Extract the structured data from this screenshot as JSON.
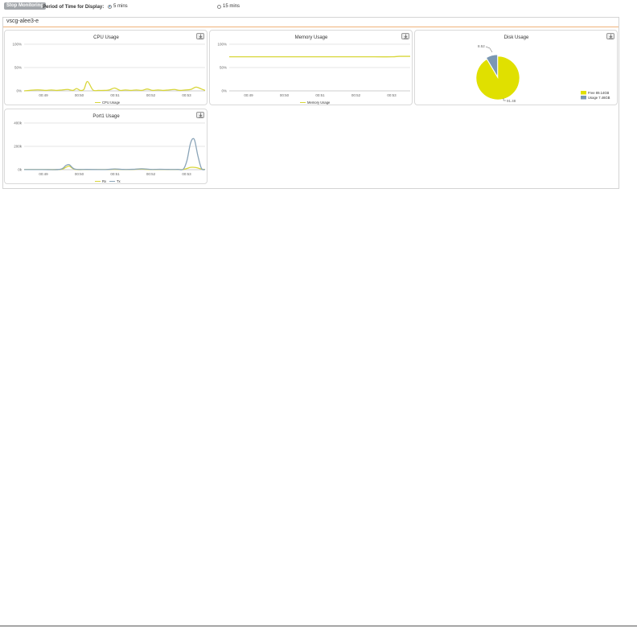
{
  "toolbar": {
    "stop_label": "Stop Monitoring",
    "period_label": "Period of Time for Display:",
    "options": [
      {
        "label": "5 mins",
        "selected": true
      },
      {
        "label": "15 mins",
        "selected": false
      }
    ]
  },
  "device": {
    "name": "vscg-alee3-e"
  },
  "colors": {
    "rx": "#d8d63a",
    "tx": "#8aa4b8",
    "free": "#e0e000",
    "usage": "#7a97b3",
    "grid": "#cccccc"
  },
  "chart_data": [
    {
      "type": "line",
      "title": "CPU Usage",
      "x_ticks": [
        "00:49",
        "00:50",
        "00:51",
        "00:52",
        "00:53"
      ],
      "y_ticks": [
        "100%",
        "50%",
        "0%"
      ],
      "ylim": [
        0,
        100
      ],
      "legend": [
        "CPU Usage"
      ],
      "series": [
        {
          "name": "CPU Usage",
          "color": "#d8d63a",
          "x": [
            0,
            0.03,
            0.06,
            0.09,
            0.12,
            0.15,
            0.18,
            0.21,
            0.24,
            0.27,
            0.29,
            0.31,
            0.33,
            0.35,
            0.38,
            0.41,
            0.44,
            0.47,
            0.5,
            0.53,
            0.56,
            0.59,
            0.62,
            0.65,
            0.68,
            0.71,
            0.74,
            0.77,
            0.8,
            0.83,
            0.86,
            0.89,
            0.92,
            0.95,
            0.98,
            1
          ],
          "y": [
            0,
            1,
            2,
            2,
            1,
            2,
            1,
            2,
            3,
            1,
            5,
            1,
            3,
            20,
            2,
            1,
            1,
            2,
            6,
            1,
            2,
            1,
            2,
            1,
            4,
            1,
            2,
            1,
            2,
            3,
            1,
            2,
            3,
            8,
            4,
            1
          ]
        }
      ]
    },
    {
      "type": "line",
      "title": "Memory Usage",
      "x_ticks": [
        "00:49",
        "00:50",
        "00:51",
        "00:52",
        "00:53"
      ],
      "y_ticks": [
        "100%",
        "50%",
        "0%"
      ],
      "ylim": [
        0,
        100
      ],
      "legend": [
        "Memory Usage"
      ],
      "series": [
        {
          "name": "Memory Usage",
          "color": "#d8d63a",
          "x": [
            0,
            0.2,
            0.4,
            0.6,
            0.8,
            0.9,
            0.94,
            1
          ],
          "y": [
            73,
            73,
            73,
            73,
            73,
            73,
            74,
            74
          ]
        }
      ]
    },
    {
      "type": "pie",
      "title": "Disk Usage",
      "slices": [
        {
          "label": "Free 89.14GB",
          "value": 91.48,
          "value_label": "91.48",
          "color": "#e0e000"
        },
        {
          "label": "Usage 7.46GB",
          "value": 8.52,
          "value_label": "8.52",
          "color": "#7a97b3"
        }
      ]
    },
    {
      "type": "line",
      "title": "Port1 Usage",
      "x_ticks": [
        "00:49",
        "00:50",
        "00:51",
        "00:52",
        "00:53"
      ],
      "y_ticks": [
        "400k",
        "200k",
        "0k"
      ],
      "ylim": [
        0,
        400000
      ],
      "legend": [
        "Rx",
        "Tx"
      ],
      "series": [
        {
          "name": "Rx",
          "color": "#d8d63a",
          "x": [
            0,
            0.1,
            0.2,
            0.23,
            0.25,
            0.28,
            0.35,
            0.45,
            0.5,
            0.55,
            0.6,
            0.65,
            0.7,
            0.75,
            0.8,
            0.85,
            0.88,
            0.9,
            0.92,
            0.95,
            0.98,
            1
          ],
          "y": [
            1000,
            1000,
            2000,
            20000,
            30000,
            3000,
            1000,
            1000,
            4000,
            1000,
            2000,
            5000,
            1000,
            2000,
            1000,
            1000,
            2000,
            10000,
            20000,
            18000,
            5000,
            1000
          ]
        },
        {
          "name": "Tx",
          "color": "#8aa4b8",
          "x": [
            0,
            0.1,
            0.2,
            0.23,
            0.25,
            0.28,
            0.35,
            0.45,
            0.5,
            0.55,
            0.6,
            0.65,
            0.7,
            0.75,
            0.8,
            0.85,
            0.88,
            0.9,
            0.92,
            0.94,
            0.96,
            0.98,
            1
          ],
          "y": [
            1000,
            1000,
            3000,
            35000,
            42000,
            5000,
            2000,
            1000,
            6000,
            2000,
            3000,
            8000,
            2000,
            3000,
            2000,
            2000,
            5000,
            80000,
            230000,
            260000,
            120000,
            10000,
            2000
          ]
        }
      ]
    }
  ]
}
